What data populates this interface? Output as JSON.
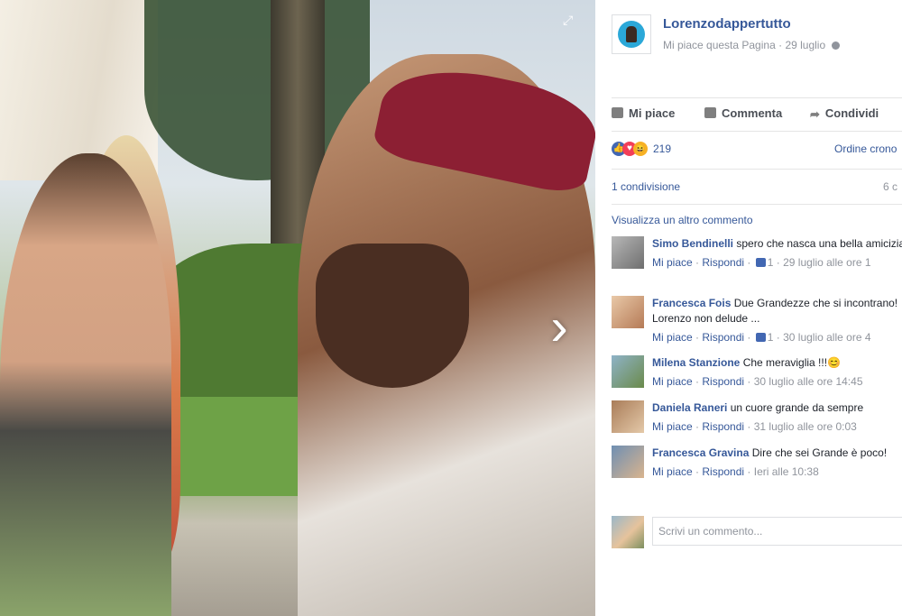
{
  "photo": {
    "alt": ""
  },
  "page": {
    "name": "Lorenzodappertutto",
    "like_text": "Mi piace questa Pagina",
    "dot": "·",
    "date": "29 luglio"
  },
  "actions": {
    "like": "Mi piace",
    "comment": "Commenta",
    "share": "Condividi"
  },
  "reactions": {
    "count": "219",
    "order": "Ordine crono"
  },
  "shares": {
    "text": "1 condivisione",
    "right": "6 c"
  },
  "more_comments": "Visualizza un altro commento",
  "comments": [
    {
      "author": "Simo Bendinelli",
      "text": " spero che nasca una bella amicizia !",
      "meta_like": "Mi piace",
      "meta_reply": "Rispondi",
      "likes": "1",
      "time": "29 luglio alle ore 1"
    },
    {
      "author": "Francesca Fois",
      "text": " Due Grandezze che si incontrano! Lorenzo non delude ...",
      "meta_like": "Mi piace",
      "meta_reply": "Rispondi",
      "likes": "1",
      "time": "30 luglio alle ore 4"
    },
    {
      "author": "Milena Stanzione",
      "text": " Che meraviglia !!!😊",
      "meta_like": "Mi piace",
      "meta_reply": "Rispondi",
      "likes": "",
      "time": "30 luglio alle ore 14:45"
    },
    {
      "author": "Daniela Raneri",
      "text": " un cuore grande da sempre",
      "meta_like": "Mi piace",
      "meta_reply": "Rispondi",
      "likes": "",
      "time": "31 luglio alle ore 0:03"
    },
    {
      "author": "Francesca Gravina",
      "text": " Dire che sei Grande è poco!",
      "meta_like": "Mi piace",
      "meta_reply": "Rispondi",
      "likes": "",
      "time": "Ieri alle 10:38"
    }
  ],
  "write": {
    "placeholder": "Scrivi un commento..."
  },
  "icons": {
    "next": "chevron-right-icon",
    "expand": "expand-icon",
    "globe": "globe-icon",
    "like": "thumbs-up-icon",
    "comment": "comment-icon",
    "share": "share-icon"
  },
  "colors": {
    "link": "#365899",
    "muted": "#90949c",
    "like_blue": "#4267b2",
    "love_red": "#f33e58",
    "haha_yellow": "#f7b125"
  }
}
